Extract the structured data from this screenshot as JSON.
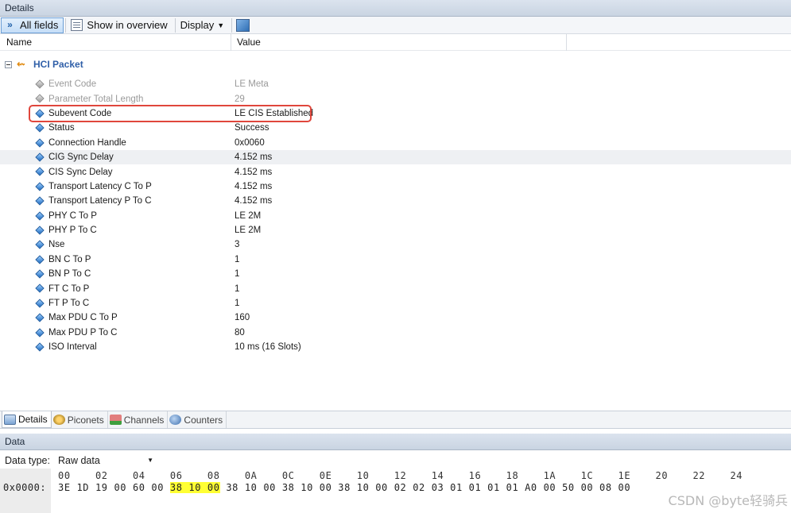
{
  "panel_title": "Details",
  "toolbar": {
    "all_fields": "All fields",
    "show_in_overview": "Show in overview",
    "display": "Display"
  },
  "columns": {
    "name": "Name",
    "value": "Value"
  },
  "tree": {
    "root_label": "HCI Packet",
    "fields": [
      {
        "name": "Event Code",
        "value": "LE Meta",
        "dimmed": true
      },
      {
        "name": "Parameter Total Length",
        "value": "29",
        "dimmed": true
      },
      {
        "name": "Subevent Code",
        "value": "LE CIS Established",
        "highlighted": true
      },
      {
        "name": "Status",
        "value": "Success"
      },
      {
        "name": "Connection Handle",
        "value": "0x0060"
      },
      {
        "name": "CIG Sync Delay",
        "value": "4.152 ms",
        "selected": true
      },
      {
        "name": "CIS Sync Delay",
        "value": "4.152 ms"
      },
      {
        "name": "Transport Latency C To P",
        "value": "4.152 ms"
      },
      {
        "name": "Transport Latency P To C",
        "value": "4.152 ms"
      },
      {
        "name": "PHY C To P",
        "value": "LE 2M"
      },
      {
        "name": "PHY P To C",
        "value": "LE 2M"
      },
      {
        "name": "Nse",
        "value": "3"
      },
      {
        "name": "BN C To P",
        "value": "1"
      },
      {
        "name": "BN P To C",
        "value": "1"
      },
      {
        "name": "FT C To P",
        "value": "1"
      },
      {
        "name": "FT P To C",
        "value": "1"
      },
      {
        "name": "Max PDU C To P",
        "value": "160"
      },
      {
        "name": "Max PDU P To C",
        "value": "80"
      },
      {
        "name": "ISO Interval",
        "value": "10 ms (16 Slots)"
      }
    ]
  },
  "bottom_tabs": [
    "Details",
    "Piconets",
    "Channels",
    "Counters"
  ],
  "data_panel": {
    "title": "Data",
    "data_type_label": "Data type:",
    "data_type_value": "Raw data",
    "offsets": [
      "00",
      "02",
      "04",
      "06",
      "08",
      "0A",
      "0C",
      "0E",
      "10",
      "12",
      "14",
      "16",
      "18",
      "1A",
      "1C",
      "1E",
      "20",
      "22",
      "24"
    ],
    "address": "0x0000:",
    "bytes": [
      "3E",
      "1D",
      "19",
      "00",
      "60",
      "00",
      "38",
      "10",
      "00",
      "38",
      "10",
      "00",
      "38",
      "10",
      "00",
      "38",
      "10",
      "00",
      "02",
      "02",
      "03",
      "01",
      "01",
      "01",
      "01",
      "A0",
      "00",
      "50",
      "00",
      "08",
      "00"
    ],
    "highlighted_byte_indices": [
      6,
      7,
      8
    ]
  },
  "watermark": "CSDN @byte轻骑兵"
}
